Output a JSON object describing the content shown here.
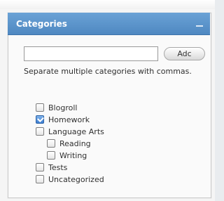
{
  "panel": {
    "title": "Categories",
    "minimize": "—"
  },
  "form": {
    "input_value": "",
    "input_placeholder": "",
    "add_button_label": "Adc",
    "helper_text": "Separate multiple categories with commas."
  },
  "categories": [
    {
      "label": "Blogroll",
      "checked": false,
      "level": 0
    },
    {
      "label": "Homework",
      "checked": true,
      "level": 0
    },
    {
      "label": "Language Arts",
      "checked": false,
      "level": 0
    },
    {
      "label": "Reading",
      "checked": false,
      "level": 1
    },
    {
      "label": "Writing",
      "checked": false,
      "level": 1
    },
    {
      "label": "Tests",
      "checked": false,
      "level": 0
    },
    {
      "label": "Uncategorized",
      "checked": false,
      "level": 0
    }
  ],
  "colors": {
    "header_blue": "#5a93cc",
    "checkbox_blue": "#3d7fd2"
  }
}
